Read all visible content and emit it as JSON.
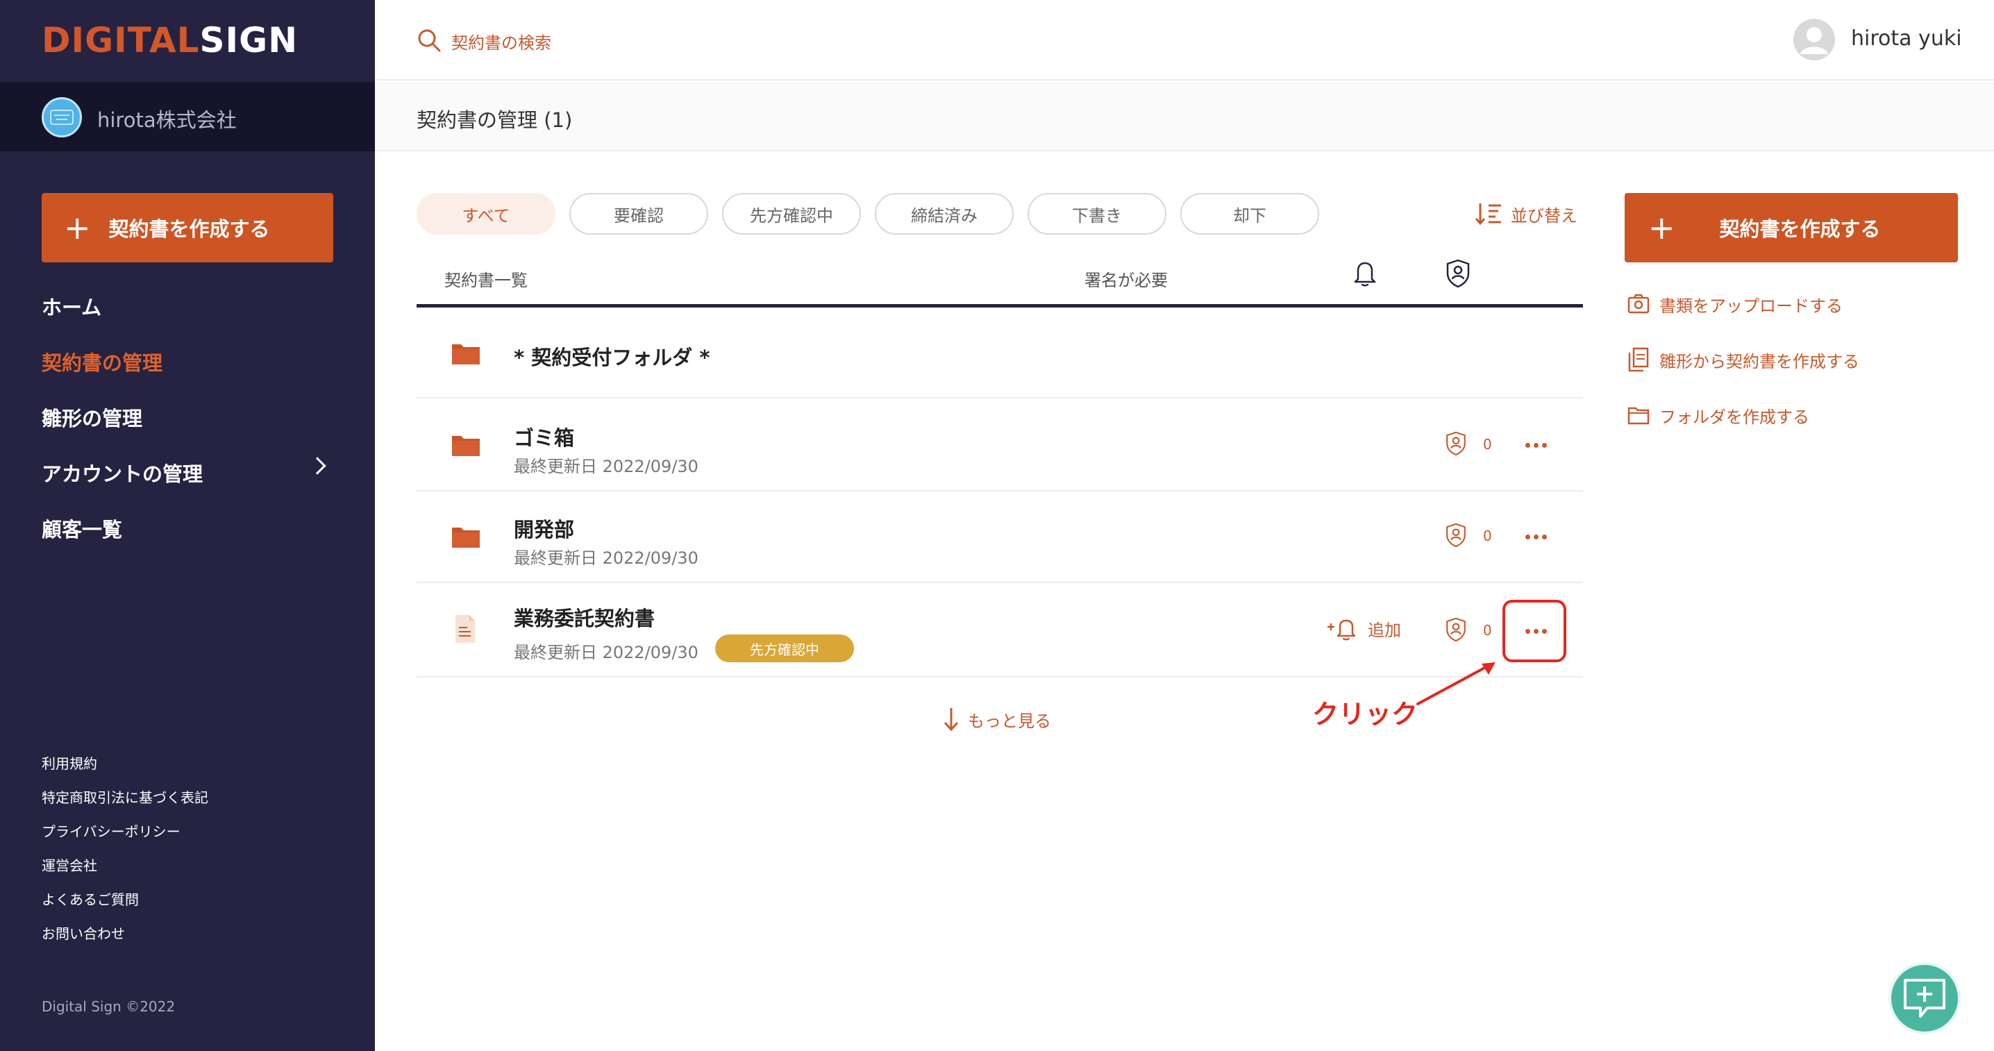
{
  "brand": {
    "logo_part1": "DIGITAL",
    "logo_part2": "SIGN",
    "accent_color": "#cd5523",
    "sidebar_color": "#252341"
  },
  "company": {
    "name": "hirota株式会社",
    "avatar_icon": "company-logo-icon"
  },
  "sidebar": {
    "create_label": "契約書を作成する",
    "nav": [
      {
        "label": "ホーム",
        "active": false
      },
      {
        "label": "契約書の管理",
        "active": true
      },
      {
        "label": "雛形の管理",
        "active": false
      },
      {
        "label": "アカウントの管理",
        "active": false,
        "has_submenu": true
      },
      {
        "label": "顧客一覧",
        "active": false
      }
    ],
    "footer_links": [
      "利用規約",
      "特定商取引法に基づく表記",
      "プライバシーポリシー",
      "運営会社",
      "よくあるご質問",
      "お問い合わせ"
    ],
    "copyright": "Digital Sign ©2022"
  },
  "header": {
    "search_placeholder": "契約書の検索",
    "user_name": "hirota yuki"
  },
  "page": {
    "title": "契約書の管理 (1)"
  },
  "filters": {
    "tabs": [
      "すべて",
      "要確認",
      "先方確認中",
      "締結済み",
      "下書き",
      "却下"
    ],
    "active_index": 0,
    "sort_label": "並び替え"
  },
  "table": {
    "col_list": "契約書一覧",
    "col_signature": "署名が必要",
    "rows": [
      {
        "type": "folder",
        "name": "* 契約受付フォルダ *"
      },
      {
        "type": "folder",
        "name": "ゴミ箱",
        "date": "最終更新日 2022/09/30",
        "count": "0"
      },
      {
        "type": "folder",
        "name": "開発部",
        "date": "最終更新日 2022/09/30",
        "count": "0"
      },
      {
        "type": "document",
        "name": "業務委託契約書",
        "date": "最終更新日 2022/09/30",
        "status": "先方確認中",
        "count": "0",
        "add_label": "追加"
      }
    ],
    "load_more": "もっと見る"
  },
  "annotation": {
    "label": "クリック",
    "color": "#e2281f"
  },
  "right_panel": {
    "create_label": "契約書を作成する",
    "actions": [
      {
        "label": "書類をアップロードする",
        "icon": "camera-icon"
      },
      {
        "label": "雛形から契約書を作成する",
        "icon": "template-icon"
      },
      {
        "label": "フォルダを作成する",
        "icon": "folder-outline-icon"
      }
    ]
  },
  "chat": {
    "icon": "chat-plus-icon"
  }
}
